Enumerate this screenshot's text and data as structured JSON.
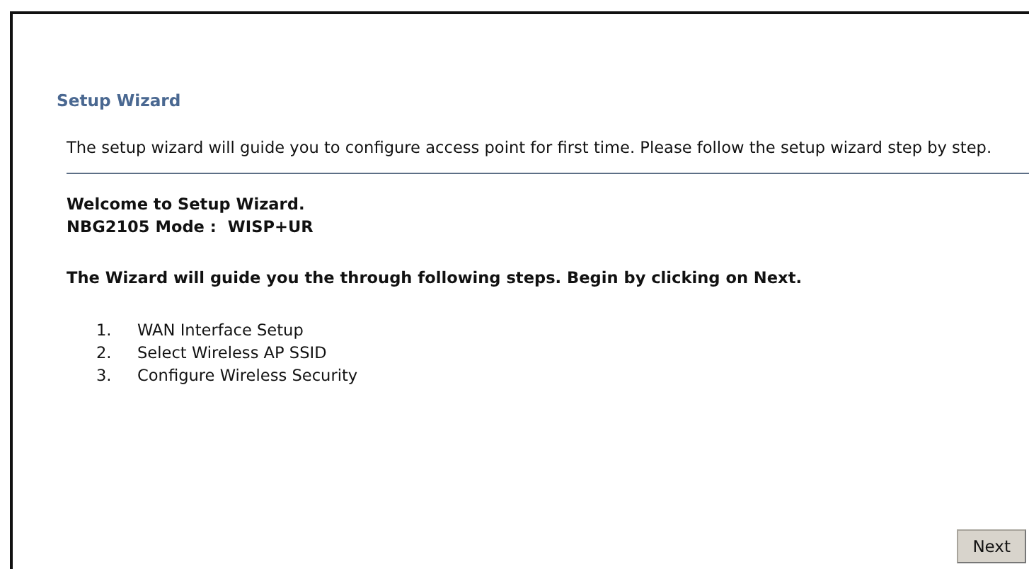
{
  "title": "Setup Wizard",
  "intro": "The setup wizard will guide you to configure access point for first time. Please follow the setup wizard step by step.",
  "welcome": "Welcome to Setup Wizard.",
  "mode": {
    "label": "NBG2105 Mode :",
    "value": "WISP+UR"
  },
  "guide": "The Wizard will guide you the through following steps. Begin by clicking on Next.",
  "steps": [
    {
      "number": "1.",
      "label": "WAN Interface Setup"
    },
    {
      "number": "2.",
      "label": "Select Wireless AP SSID"
    },
    {
      "number": "3.",
      "label": "Configure Wireless Security"
    }
  ],
  "buttons": [
    "Next"
  ]
}
